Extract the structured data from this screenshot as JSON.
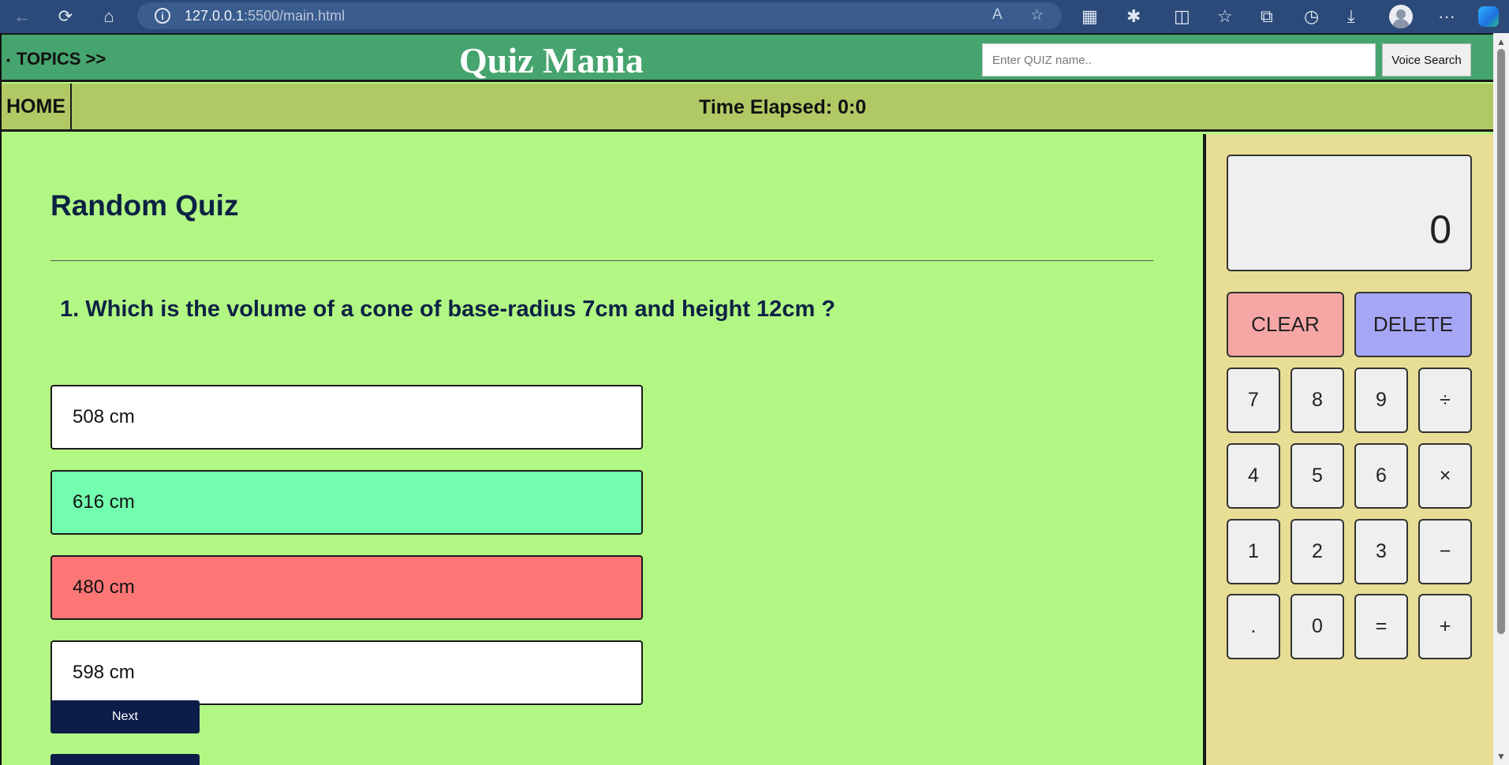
{
  "browser": {
    "url_host": "127.0.0.1",
    "url_path": ":5500/main.html"
  },
  "header": {
    "topics_label": "TOPICS >>",
    "brand": "Quiz Mania",
    "search_placeholder": "Enter QUIZ name..",
    "voice_search_label": "Voice Search"
  },
  "subnav": {
    "home_label": "HOME",
    "timer_text": "Time Elapsed: 0:0"
  },
  "quiz": {
    "title": "Random Quiz",
    "question": "1. Which is the volume of a cone of base-radius 7cm and height 12cm ?",
    "options": [
      {
        "text": "508 cm",
        "state": "neutral"
      },
      {
        "text": "616 cm",
        "state": "correct"
      },
      {
        "text": "480 cm",
        "state": "wrong"
      },
      {
        "text": "598 cm",
        "state": "neutral"
      }
    ],
    "next_label": "Next"
  },
  "calculator": {
    "display": "0",
    "clear_label": "CLEAR",
    "delete_label": "DELETE",
    "keys": [
      "7",
      "8",
      "9",
      "÷",
      "4",
      "5",
      "6",
      "×",
      "1",
      "2",
      "3",
      "−",
      ".",
      "0",
      "=",
      "+"
    ]
  },
  "colors": {
    "header_bg": "#46a46e",
    "subnav_bg": "#b1c965",
    "quiz_bg": "#b2f784",
    "calc_bg": "#e8dd95",
    "correct": "#73fdaf",
    "wrong": "#fd7676",
    "button_dark": "#0b1d48"
  }
}
